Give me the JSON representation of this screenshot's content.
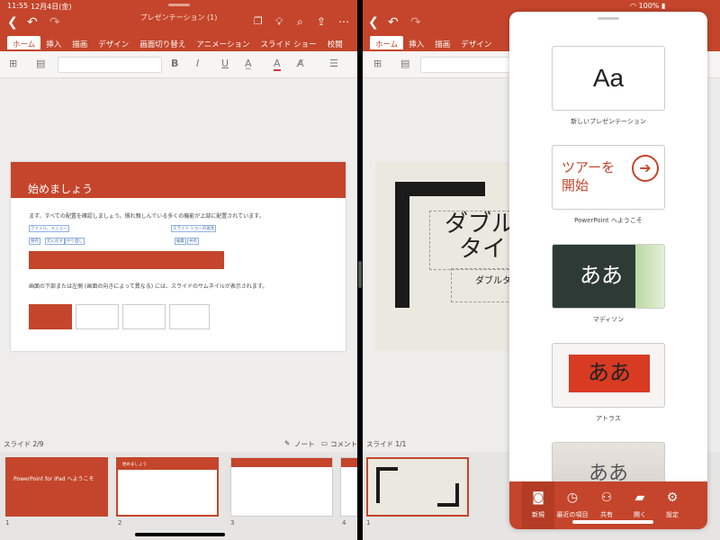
{
  "status": {
    "time": "11:55",
    "date": "12月4日(金)",
    "battery": "100%"
  },
  "left": {
    "doc_title": "プレゼンテーション (1)",
    "tabs": [
      "ホーム",
      "挿入",
      "描画",
      "デザイン",
      "画面切り替え",
      "アニメーション",
      "スライド ショー",
      "校閲"
    ],
    "slide": {
      "title": "始めましょう",
      "line1": "まず、すべての配置を確認しましょう。慣れ親しんでいる多くの機能が上部に配置されています。",
      "labels": {
        "file_menu": "ファイル、メニュー",
        "save": "保存",
        "undo": "元に戻す",
        "redo": "やり直し",
        "slideshow": "スライド ショーの再生",
        "edit": "編集",
        "share": "共有"
      },
      "line2": "画面の下部または左側 (画面の向きによって異なる) には、スライドのサムネイルが表示されます。"
    },
    "slide_counter": "スライド 2/9",
    "notes": "ノート",
    "comments": "コメント",
    "thumb1_title": "PowerPoint for iPad へようこそ",
    "thumb2_title": "始めましょう",
    "thumb_nums": [
      "1",
      "2",
      "3",
      "4"
    ]
  },
  "right": {
    "slide_text1": "ダブル",
    "slide_text2": "タイ",
    "slide_sub": "ダブルタッ",
    "slide_counter": "スライド 1/1",
    "thumb_num": "1"
  },
  "panel": {
    "templates": [
      {
        "label": "新しいプレゼンテーション",
        "preview": "Aa"
      },
      {
        "label": "PowerPoint へようこそ",
        "preview": "ツアーを\n開始"
      },
      {
        "label": "マディソン",
        "preview": "ああ"
      },
      {
        "label": "アトラス",
        "preview": "ああ"
      },
      {
        "label": "",
        "preview": "ああ"
      }
    ],
    "nav": [
      {
        "label": "新規",
        "icon": "new-doc-icon"
      },
      {
        "label": "最近の項目",
        "icon": "clock-icon"
      },
      {
        "label": "共有",
        "icon": "people-icon"
      },
      {
        "label": "開く",
        "icon": "folder-icon"
      },
      {
        "label": "設定",
        "icon": "gear-icon"
      }
    ]
  },
  "colors": {
    "accent": "#c4452b",
    "background": "#eeedec"
  }
}
